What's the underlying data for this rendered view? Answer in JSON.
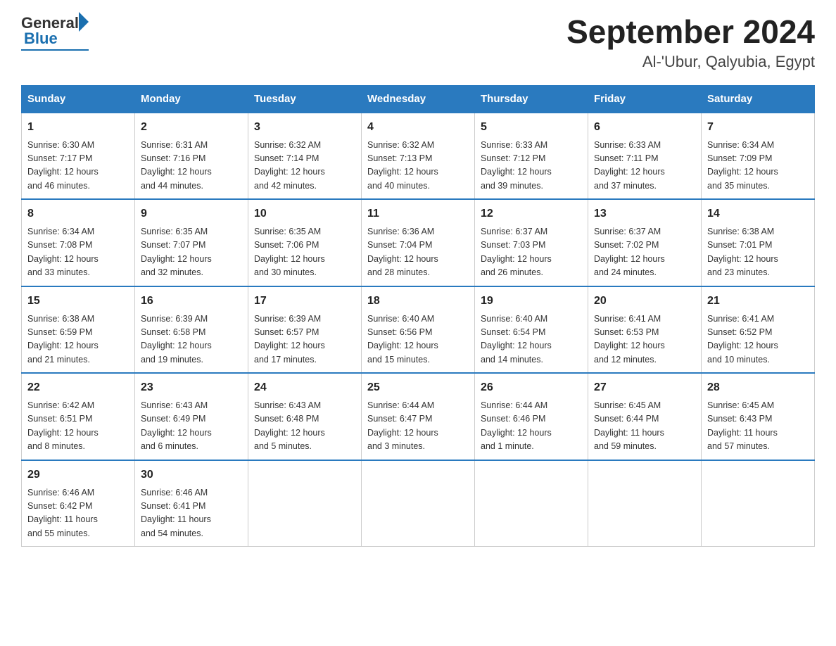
{
  "header": {
    "title": "September 2024",
    "subtitle": "Al-'Ubur, Qalyubia, Egypt",
    "logo_general": "General",
    "logo_blue": "Blue"
  },
  "weekdays": [
    "Sunday",
    "Monday",
    "Tuesday",
    "Wednesday",
    "Thursday",
    "Friday",
    "Saturday"
  ],
  "weeks": [
    [
      {
        "day": "1",
        "sunrise": "6:30 AM",
        "sunset": "7:17 PM",
        "daylight": "12 hours and 46 minutes."
      },
      {
        "day": "2",
        "sunrise": "6:31 AM",
        "sunset": "7:16 PM",
        "daylight": "12 hours and 44 minutes."
      },
      {
        "day": "3",
        "sunrise": "6:32 AM",
        "sunset": "7:14 PM",
        "daylight": "12 hours and 42 minutes."
      },
      {
        "day": "4",
        "sunrise": "6:32 AM",
        "sunset": "7:13 PM",
        "daylight": "12 hours and 40 minutes."
      },
      {
        "day": "5",
        "sunrise": "6:33 AM",
        "sunset": "7:12 PM",
        "daylight": "12 hours and 39 minutes."
      },
      {
        "day": "6",
        "sunrise": "6:33 AM",
        "sunset": "7:11 PM",
        "daylight": "12 hours and 37 minutes."
      },
      {
        "day": "7",
        "sunrise": "6:34 AM",
        "sunset": "7:09 PM",
        "daylight": "12 hours and 35 minutes."
      }
    ],
    [
      {
        "day": "8",
        "sunrise": "6:34 AM",
        "sunset": "7:08 PM",
        "daylight": "12 hours and 33 minutes."
      },
      {
        "day": "9",
        "sunrise": "6:35 AM",
        "sunset": "7:07 PM",
        "daylight": "12 hours and 32 minutes."
      },
      {
        "day": "10",
        "sunrise": "6:35 AM",
        "sunset": "7:06 PM",
        "daylight": "12 hours and 30 minutes."
      },
      {
        "day": "11",
        "sunrise": "6:36 AM",
        "sunset": "7:04 PM",
        "daylight": "12 hours and 28 minutes."
      },
      {
        "day": "12",
        "sunrise": "6:37 AM",
        "sunset": "7:03 PM",
        "daylight": "12 hours and 26 minutes."
      },
      {
        "day": "13",
        "sunrise": "6:37 AM",
        "sunset": "7:02 PM",
        "daylight": "12 hours and 24 minutes."
      },
      {
        "day": "14",
        "sunrise": "6:38 AM",
        "sunset": "7:01 PM",
        "daylight": "12 hours and 23 minutes."
      }
    ],
    [
      {
        "day": "15",
        "sunrise": "6:38 AM",
        "sunset": "6:59 PM",
        "daylight": "12 hours and 21 minutes."
      },
      {
        "day": "16",
        "sunrise": "6:39 AM",
        "sunset": "6:58 PM",
        "daylight": "12 hours and 19 minutes."
      },
      {
        "day": "17",
        "sunrise": "6:39 AM",
        "sunset": "6:57 PM",
        "daylight": "12 hours and 17 minutes."
      },
      {
        "day": "18",
        "sunrise": "6:40 AM",
        "sunset": "6:56 PM",
        "daylight": "12 hours and 15 minutes."
      },
      {
        "day": "19",
        "sunrise": "6:40 AM",
        "sunset": "6:54 PM",
        "daylight": "12 hours and 14 minutes."
      },
      {
        "day": "20",
        "sunrise": "6:41 AM",
        "sunset": "6:53 PM",
        "daylight": "12 hours and 12 minutes."
      },
      {
        "day": "21",
        "sunrise": "6:41 AM",
        "sunset": "6:52 PM",
        "daylight": "12 hours and 10 minutes."
      }
    ],
    [
      {
        "day": "22",
        "sunrise": "6:42 AM",
        "sunset": "6:51 PM",
        "daylight": "12 hours and 8 minutes."
      },
      {
        "day": "23",
        "sunrise": "6:43 AM",
        "sunset": "6:49 PM",
        "daylight": "12 hours and 6 minutes."
      },
      {
        "day": "24",
        "sunrise": "6:43 AM",
        "sunset": "6:48 PM",
        "daylight": "12 hours and 5 minutes."
      },
      {
        "day": "25",
        "sunrise": "6:44 AM",
        "sunset": "6:47 PM",
        "daylight": "12 hours and 3 minutes."
      },
      {
        "day": "26",
        "sunrise": "6:44 AM",
        "sunset": "6:46 PM",
        "daylight": "12 hours and 1 minute."
      },
      {
        "day": "27",
        "sunrise": "6:45 AM",
        "sunset": "6:44 PM",
        "daylight": "11 hours and 59 minutes."
      },
      {
        "day": "28",
        "sunrise": "6:45 AM",
        "sunset": "6:43 PM",
        "daylight": "11 hours and 57 minutes."
      }
    ],
    [
      {
        "day": "29",
        "sunrise": "6:46 AM",
        "sunset": "6:42 PM",
        "daylight": "11 hours and 55 minutes."
      },
      {
        "day": "30",
        "sunrise": "6:46 AM",
        "sunset": "6:41 PM",
        "daylight": "11 hours and 54 minutes."
      },
      null,
      null,
      null,
      null,
      null
    ]
  ],
  "labels": {
    "sunrise": "Sunrise:",
    "sunset": "Sunset:",
    "daylight": "Daylight:"
  }
}
